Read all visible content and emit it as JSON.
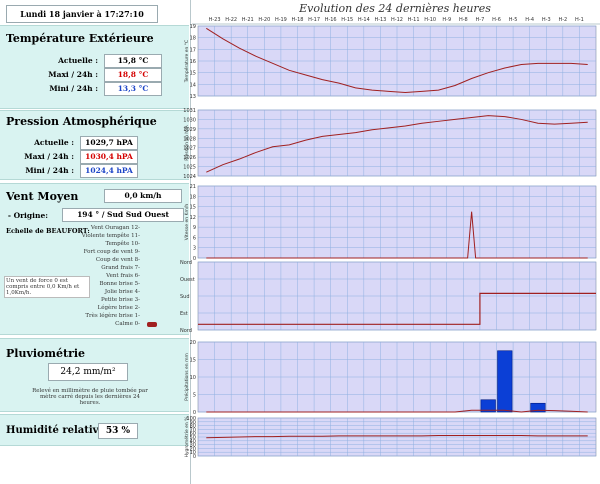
{
  "header": {
    "datetime": "Lundi 18 janvier à 17:27:10",
    "chart_title": "Evolution des 24 dernières heures"
  },
  "hours": [
    "H-23",
    "H-22",
    "H-21",
    "H-20",
    "H-19",
    "H-18",
    "H-17",
    "H-16",
    "H-15",
    "H-14",
    "H-13",
    "H-12",
    "H-11",
    "H-10",
    "H-9",
    "H-8",
    "H-7",
    "H-6",
    "H-5",
    "H-4",
    "H-3",
    "H-2",
    "H-1"
  ],
  "temperature": {
    "title": "Température Extérieure",
    "actual_label": "Actuelle :",
    "actual_value": "15,8 °C",
    "max_label": "Maxi / 24h :",
    "max_value": "18,8 °C",
    "min_label": "Mini / 24h :",
    "min_value": "13,3 °C"
  },
  "pressure": {
    "title": "Pression Atmosphérique",
    "actual_label": "Actuelle :",
    "actual_value": "1029,7 hPA",
    "max_label": "Maxi / 24h :",
    "max_value": "1030,4 hPA",
    "min_label": "Mini / 24h :",
    "min_value": "1024,4 hPA"
  },
  "wind": {
    "title": "Vent Moyen",
    "speed_value": "0,0 km/h",
    "origin_label": "- Origine:",
    "origin_value": "194 ° / Sud Sud Ouest",
    "beaufort_title": "Echelle de BEAUFORT:",
    "beaufort": [
      "Vent Ouragan 12-",
      "Violente tempête 11-",
      "Tempête 10-",
      "Fort coup de vent 9-",
      "Coup de vent 8-",
      "Grand frais 7-",
      "Vent frais 6-",
      "Bonne brise 5-",
      "Jolie brise 4-",
      "Petite brise 3-",
      "Légère brise 2-",
      "Très légère brise 1-",
      "Calme 0-"
    ],
    "note": "Un vent de force 0 est compris entre 0,0 Km/h et 1,0Km/h."
  },
  "rain": {
    "title": "Pluviométrie",
    "value": "24,2 mm/m²",
    "note": "Relevé en millimètre de pluie tombée par mètre carré depuis les dernières 24 heures."
  },
  "humidity": {
    "title": "Humidité relative",
    "value": "53 %"
  },
  "colors": {
    "panel": "#d9f3f1",
    "grid": "#8fb0e0",
    "plot_bg": "#d9d8f7",
    "line": "#a02020",
    "bar": "#0b3fd6"
  },
  "chart_data": [
    {
      "type": "line",
      "ylabel": "Température en °C",
      "ylim": [
        13,
        19
      ],
      "yticks": [
        13,
        14,
        15,
        16,
        17,
        18,
        19
      ],
      "x": [
        "H-23",
        "H-22",
        "H-21",
        "H-20",
        "H-19",
        "H-18",
        "H-17",
        "H-16",
        "H-15",
        "H-14",
        "H-13",
        "H-12",
        "H-11",
        "H-10",
        "H-9",
        "H-8",
        "H-7",
        "H-6",
        "H-5",
        "H-4",
        "H-3",
        "H-2",
        "H-1",
        "H-0"
      ],
      "values": [
        18.8,
        17.9,
        17.1,
        16.4,
        15.8,
        15.2,
        14.8,
        14.4,
        14.1,
        13.7,
        13.5,
        13.4,
        13.3,
        13.4,
        13.5,
        13.9,
        14.5,
        15.0,
        15.4,
        15.7,
        15.8,
        15.8,
        15.8,
        15.7
      ]
    },
    {
      "type": "line",
      "ylabel": "Pression en hPA",
      "ylim": [
        1024,
        1031
      ],
      "yticks": [
        1024,
        1025,
        1026,
        1027,
        1028,
        1029,
        1030,
        1031
      ],
      "x": [
        "H-23",
        "H-22",
        "H-21",
        "H-20",
        "H-19",
        "H-18",
        "H-17",
        "H-16",
        "H-15",
        "H-14",
        "H-13",
        "H-12",
        "H-11",
        "H-10",
        "H-9",
        "H-8",
        "H-7",
        "H-6",
        "H-5",
        "H-4",
        "H-3",
        "H-2",
        "H-1",
        "H-0"
      ],
      "values": [
        1024.4,
        1025.2,
        1025.8,
        1026.5,
        1027.1,
        1027.3,
        1027.8,
        1028.2,
        1028.4,
        1028.6,
        1028.9,
        1029.1,
        1029.3,
        1029.6,
        1029.8,
        1030.0,
        1030.2,
        1030.4,
        1030.3,
        1030.0,
        1029.6,
        1029.5,
        1029.6,
        1029.7
      ]
    },
    {
      "type": "line",
      "ylabel": "Vitesse en Km/h",
      "ylim": [
        0,
        21
      ],
      "yticks": [
        0,
        3,
        6,
        9,
        12,
        15,
        18,
        21
      ],
      "x": [
        "H-23",
        "H-22",
        "H-21",
        "H-20",
        "H-19",
        "H-18",
        "H-17",
        "H-16",
        "H-15",
        "H-14",
        "H-13",
        "H-12",
        "H-11",
        "H-10",
        "H-9",
        "H-8",
        "H-7",
        "H-6",
        "H-5",
        "H-4",
        "H-3",
        "H-2",
        "H-1",
        "H-0"
      ],
      "values": [
        0,
        0,
        0,
        0,
        0,
        0,
        0,
        0,
        0,
        0,
        0,
        0,
        0,
        0,
        0,
        0,
        13.5,
        0,
        0,
        0,
        0,
        0,
        0,
        0
      ]
    },
    {
      "type": "line",
      "ylabel": "",
      "ytick_labels": [
        "Nord",
        "Ouest",
        "Sud",
        "Est",
        "Nord"
      ],
      "ylim": [
        0,
        360
      ],
      "x": [
        "H-23",
        "H-22",
        "H-21",
        "H-20",
        "H-19",
        "H-18",
        "H-17",
        "H-16",
        "H-15",
        "H-14",
        "H-13",
        "H-12",
        "H-11",
        "H-10",
        "H-9",
        "H-8",
        "H-7",
        "H-6",
        "H-5",
        "H-4",
        "H-3",
        "H-2",
        "H-1",
        "H-0"
      ],
      "values": [
        30,
        30,
        30,
        30,
        30,
        30,
        30,
        30,
        30,
        30,
        30,
        30,
        30,
        30,
        30,
        30,
        30,
        194,
        194,
        194,
        194,
        194,
        194,
        194
      ]
    },
    {
      "type": "bar",
      "ylabel": "Précipitations en mm",
      "ylim": [
        0,
        20
      ],
      "yticks": [
        0,
        5,
        10,
        15,
        20
      ],
      "categories": [
        "H-23",
        "H-22",
        "H-21",
        "H-20",
        "H-19",
        "H-18",
        "H-17",
        "H-16",
        "H-15",
        "H-14",
        "H-13",
        "H-12",
        "H-11",
        "H-10",
        "H-9",
        "H-8",
        "H-7",
        "H-6",
        "H-5",
        "H-4",
        "H-3",
        "H-2",
        "H-1",
        "H-0"
      ],
      "values": [
        0,
        0,
        0,
        0,
        0,
        0,
        0,
        0,
        0,
        0,
        0,
        0,
        0,
        0,
        0,
        0,
        0.5,
        3.5,
        17.5,
        0,
        2.5,
        0.4,
        0.2,
        0
      ]
    },
    {
      "type": "line",
      "ylabel": "Hygrométrie en %",
      "ylim": [
        0,
        100
      ],
      "yticks": [
        0,
        10,
        20,
        30,
        40,
        50,
        60,
        70,
        80,
        90,
        100
      ],
      "x": [
        "H-23",
        "H-22",
        "H-21",
        "H-20",
        "H-19",
        "H-18",
        "H-17",
        "H-16",
        "H-15",
        "H-14",
        "H-13",
        "H-12",
        "H-11",
        "H-10",
        "H-9",
        "H-8",
        "H-7",
        "H-6",
        "H-5",
        "H-4",
        "H-3",
        "H-2",
        "H-1",
        "H-0"
      ],
      "values": [
        48,
        49,
        50,
        51,
        51,
        52,
        52,
        52,
        53,
        53,
        53,
        53,
        53,
        53,
        54,
        54,
        54,
        54,
        54,
        54,
        53,
        53,
        53,
        53
      ]
    }
  ]
}
